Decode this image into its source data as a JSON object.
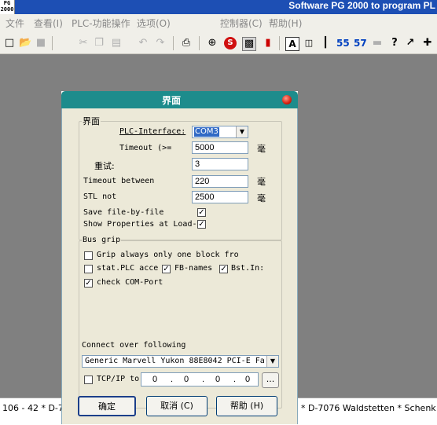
{
  "app": {
    "icon_text": "PG 2000",
    "title": "Software PG 2000 to program PL"
  },
  "menu": [
    {
      "label": "文件"
    },
    {
      "label": "查看(I)"
    },
    {
      "label": "PLC-功能操作"
    },
    {
      "label": "选项(O)"
    },
    {
      "label": "控制器(C)"
    },
    {
      "label": "帮助(H)"
    }
  ],
  "toolbar": {
    "s5_label": "55",
    "s7_label": "57",
    "help_label": "?"
  },
  "status": {
    "left": "106 - 42 * D-706",
    "right": "* D-7076 Waldstetten * Schenk Filte"
  },
  "dialog": {
    "title": "界面",
    "group1": {
      "legend": "界面",
      "plc_interface_label": "PLC-Interface:",
      "plc_interface_value": "COM3",
      "timeout_label": "Timeout (>=",
      "timeout_value": "5000",
      "timeout_unit": "毫",
      "retry_label": "重试:",
      "retry_value": "3",
      "timeout_between_label": "Timeout between",
      "timeout_between_value": "220",
      "timeout_between_unit": "毫",
      "stl_label": "STL not",
      "stl_value": "2500",
      "stl_unit": "毫",
      "save_file_label": "Save file-by-file",
      "save_file_checked": true,
      "show_props_label": "Show Properties at Load-",
      "show_props_checked": true
    },
    "group2": {
      "legend": "Bus grip",
      "grip_label": "Grip always only one block fro",
      "grip_checked": false,
      "stat_plc_label": "stat.PLC acce",
      "stat_plc_checked": false,
      "fb_names_label": "FB-names",
      "fb_names_checked": true,
      "bst_in_label": "Bst.In:",
      "bst_in_checked": true,
      "check_com_label": "check COM-Port",
      "check_com_checked": true,
      "connect_label": "Connect over following",
      "adapter_value": "Generic Marvell Yukon 88E8042 PCI-E Fa",
      "tcpip_label": "TCP/IP to",
      "tcpip_checked": false,
      "ip_parts": [
        "0",
        "0",
        "0",
        "0"
      ],
      "ip_dots": [
        ".",
        ".",
        "."
      ],
      "browse_label": "..."
    },
    "buttons": {
      "ok": "确定",
      "cancel": "取消 (C)",
      "help": "帮助 (H)"
    }
  }
}
